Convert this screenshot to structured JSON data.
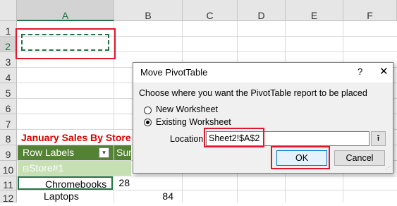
{
  "sheet": {
    "columns": [
      "A",
      "B",
      "C",
      "D",
      "E",
      "F"
    ],
    "rows": [
      "1",
      "2",
      "3",
      "4",
      "5",
      "6",
      "7",
      "8",
      "9",
      "10",
      "11",
      "12"
    ],
    "cells": {
      "a8_title": "January Sales By Store",
      "a9_row_labels": "Row Labels",
      "b9_sum": "Sum",
      "a10_store": "Store#1",
      "a11_item": "Chromebooks",
      "b11_value": "28",
      "a12_item": "Laptops",
      "b12_value": "84"
    },
    "collapse_glyph": "⊟",
    "filter_glyph": "▾"
  },
  "dialog": {
    "title": "Move PivotTable",
    "help": "?",
    "close": "✕",
    "prompt": "Choose where you want the PivotTable report to be placed",
    "option_new": "New Worksheet",
    "option_existing": "Existing Worksheet",
    "selected_option": "Existing Worksheet",
    "location_label": "Location:",
    "location_value": "Sheet2!$A$2",
    "picker_glyph": "⭱",
    "ok": "OK",
    "cancel": "Cancel"
  },
  "colors": {
    "pivot_header": "#548235",
    "pivot_subheader": "#c6e0b4",
    "title_text": "#d50000",
    "highlight_box": "#e0182d",
    "selection": "#217346"
  }
}
